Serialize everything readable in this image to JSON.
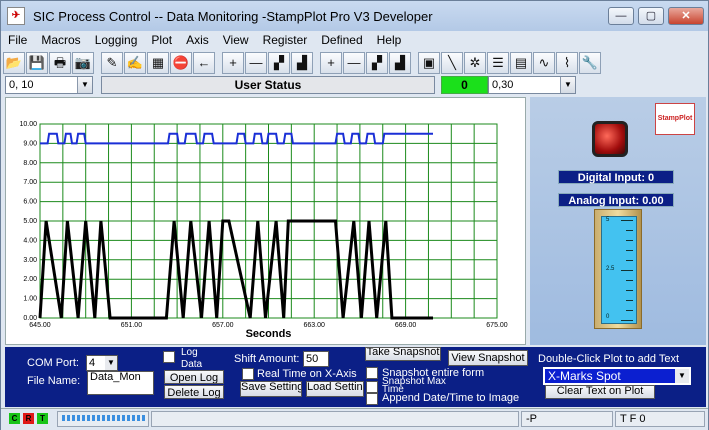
{
  "window": {
    "title": "SIC Process Control -- Data Monitoring  -StampPlot Pro V3 Developer",
    "icon": "stamp-plot-app-icon",
    "min_label": "—",
    "max_label": "▢",
    "close_label": "✕"
  },
  "menu": [
    "File",
    "Macros",
    "Logging",
    "Plot",
    "Axis",
    "View",
    "Register",
    "Defined",
    "Help"
  ],
  "toolbar": {
    "icons": [
      "open-folder-icon",
      "save-disk-icon",
      "print-icon",
      "camera-icon",
      "pen-icon",
      "pencil-icon",
      "chart-icon",
      "stop-icon",
      "arrow-left-icon",
      "plus-icon",
      "minus-icon",
      "zoom-in-icon",
      "zoom-out-icon",
      "plus-icon",
      "minus-icon",
      "zoom-in-icon",
      "zoom-out-icon",
      "snapshot-icon",
      "line-icon",
      "draw-icon",
      "note-icon",
      "calculator-icon",
      "probe-icon",
      "graph-icon",
      "wrench-icon"
    ],
    "glyphs": [
      "📂",
      "💾",
      "🖶",
      "📷",
      "✎",
      "✍",
      "▦",
      "⛔",
      "←",
      "+",
      "—",
      "▞",
      "▟",
      "+",
      "—",
      "▞",
      "▟",
      "▣",
      "╲",
      "✲",
      "☰",
      "▤",
      "∿",
      "⌇",
      "🔧"
    ]
  },
  "status": {
    "left_combo": "0, 10",
    "user_status": "User Status",
    "green_value": "0",
    "right_combo": "0,30"
  },
  "chart_data": {
    "type": "line",
    "xlabel": "Seconds",
    "xlim": [
      645.0,
      675.0
    ],
    "ylim": [
      0.0,
      10.0
    ],
    "xticks": [
      "645.00",
      "651.00",
      "657.00",
      "663.00",
      "669.00",
      "675.00"
    ],
    "yticks": [
      "0.00",
      "1.00",
      "2.00",
      "3.00",
      "4.00",
      "5.00",
      "6.00",
      "7.00",
      "8.00",
      "9.00",
      "10.00"
    ],
    "grid": true,
    "series": [
      {
        "color": "#1a2fd6",
        "x": [
          645,
          645.5,
          645.6,
          646.1,
          646.2,
          646.6,
          646.7,
          647,
          647.1,
          647.4,
          647.5,
          647.9,
          648,
          648.2,
          648.3,
          653.4,
          653.5,
          654,
          654.1,
          654.5,
          654.6,
          655.2,
          655.3,
          655.7,
          655.8,
          656.3,
          656.4,
          656.7,
          656.8,
          657.9,
          658,
          658.4,
          658.5,
          659,
          659.1,
          659.5,
          659.6,
          659.9,
          660,
          660.5,
          660.6,
          661,
          661.1,
          661.5,
          661.6,
          664.4,
          664.5,
          664.9,
          665,
          665.4,
          665.5,
          665.9,
          666,
          666.4,
          666.5,
          666.9,
          667,
          667.5,
          667.6,
          670.8
        ],
        "y": [
          9,
          9,
          9.5,
          9.5,
          9,
          9,
          9.5,
          9.5,
          9,
          9,
          9.5,
          9.5,
          9,
          9,
          9,
          9,
          9.5,
          9.5,
          9,
          9,
          9.5,
          9.5,
          9,
          9,
          9.5,
          9.5,
          9,
          9,
          9,
          9,
          9.5,
          9.5,
          9,
          9,
          9.5,
          9.5,
          9,
          9,
          9.5,
          9.5,
          9,
          9,
          9.5,
          9.5,
          9,
          9,
          9.5,
          9.5,
          9,
          9,
          9.5,
          9.5,
          9,
          9,
          9.5,
          9.5,
          9,
          9,
          9.5,
          9.5
        ]
      },
      {
        "color": "#000000",
        "x": [
          645,
          645.4,
          646.4,
          646.8,
          647.5,
          648,
          648.6,
          649,
          649.6,
          650.2,
          653.3,
          653.8,
          654.4,
          654.9,
          655.6,
          656.1,
          656.6,
          657,
          657.4,
          658.8,
          659.3,
          659.8,
          660.5,
          661,
          661.3,
          662.8,
          663.3,
          664.4,
          664.9,
          665.6,
          666.1,
          666.6,
          667.1,
          667.7,
          668.1,
          668.6,
          670.8
        ],
        "y": [
          0,
          5,
          0,
          5,
          0,
          5,
          0,
          5,
          0,
          0,
          0,
          5,
          0,
          5,
          0,
          5,
          0,
          5,
          5,
          0,
          5,
          0,
          5,
          0,
          5,
          5,
          5,
          5,
          0,
          5,
          0,
          5,
          0,
          5,
          0,
          0,
          0
        ]
      }
    ]
  },
  "right": {
    "logo_text": "StampPlot",
    "digital_input": "Digital Input: 0",
    "analog_input": "Analog Input: 0.00",
    "gauge_value": 0.0,
    "gauge_labels": [
      "5",
      "2.5",
      "0"
    ]
  },
  "bottom": {
    "com_port_label": "COM Port:",
    "com_port_value": "4",
    "log_label": "Log",
    "data_label": "Data",
    "shift_label": "Shift Amount:",
    "shift_value": "50",
    "take_snapshot": "Take Snapshot",
    "view_snapshot": "View Snapshot",
    "double_click_hint": "Double-Click Plot to add Text",
    "file_name_label": "File Name:",
    "file_name_value": "Data_Mon",
    "open_log": "Open Log",
    "delete_log": "Delete Log",
    "real_time": "Real Time on X-Axis",
    "save_settings": "Save Settings",
    "load_settings": "Load Settings",
    "snap_entire": "Snapshot entire form",
    "snap_max": "Snapshot Max",
    "time": "Time",
    "append_date": "Append Date/Time to Image",
    "text_select": "X-Marks Spot",
    "clear_text": "Clear Text on Plot"
  },
  "statusbar": {
    "leds": [
      {
        "label": "C",
        "color": "#18c418"
      },
      {
        "label": "R",
        "color": "#e01818"
      },
      {
        "label": "T",
        "color": "#18c418"
      }
    ],
    "field2": "-P",
    "field3": "T F 0"
  }
}
